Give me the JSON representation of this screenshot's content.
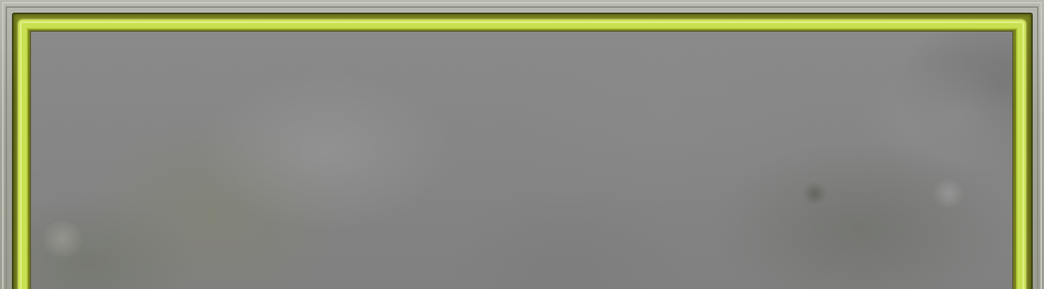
{
  "window": {
    "title": ""
  },
  "colors": {
    "bezel": "#a4a69c",
    "olive_rim": "#767d1e",
    "glow_border": "#c9e052",
    "panel_fill": "#858585"
  },
  "panel": {
    "content": ""
  }
}
